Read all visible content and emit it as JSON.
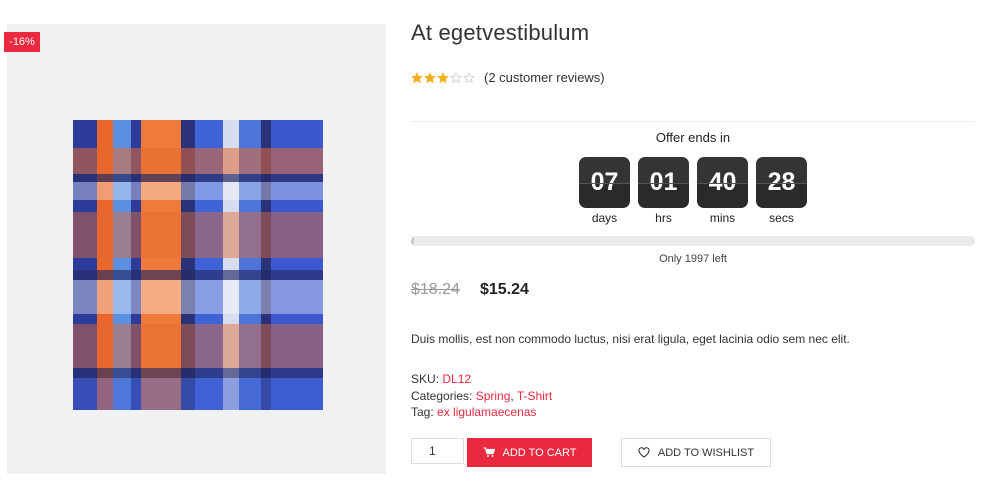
{
  "product": {
    "sale_badge": "-16%",
    "title": "At egetvestibulum",
    "rating": {
      "value": 3,
      "out_of": 5,
      "reviews_text": "(2 customer reviews)"
    },
    "offer": {
      "label": "Offer ends in",
      "countdown": [
        {
          "value": "07",
          "label": "days"
        },
        {
          "value": "01",
          "label": "hrs"
        },
        {
          "value": "40",
          "label": "mins"
        },
        {
          "value": "28",
          "label": "secs"
        }
      ],
      "stock_progress_percent": 0.5,
      "stock_text": "Only 1997 left"
    },
    "price": {
      "old": "$18.24",
      "current": "$15.24"
    },
    "description": "Duis mollis, est non commodo luctus, nisi erat ligula, eget lacinia odio sem nec elit.",
    "meta": {
      "sku_label": "SKU:",
      "sku_value": "DL12",
      "categories_label": "Categories:",
      "categories": [
        "Spring",
        "T-Shirt"
      ],
      "categories_separator": ", ",
      "tag_label": "Tag:",
      "tag_value": "ex ligulamaecenas"
    },
    "quantity": "1",
    "add_to_cart_label": "ADD TO CART",
    "add_to_wishlist_label": "ADD TO WISHLIST"
  },
  "colors": {
    "accent": "#e8293f",
    "star": "#f2b01e",
    "countdown_bg": "#2a2a2a"
  },
  "icons": {
    "cart": "cart-icon",
    "wishlist": "heart-icon",
    "star": "star-icon"
  }
}
